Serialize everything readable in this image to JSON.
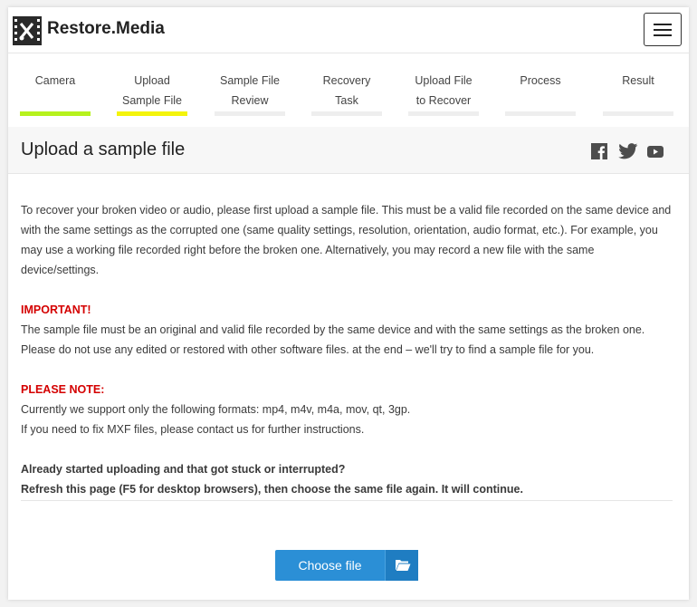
{
  "header": {
    "brand": "Restore.Media",
    "menu_icon": "hamburger-icon"
  },
  "steps": [
    {
      "line1": "Camera",
      "line2": "",
      "bar_color": "#b6f21d"
    },
    {
      "line1": "Upload",
      "line2": "Sample File",
      "bar_color": "#f4f40b"
    },
    {
      "line1": "Sample File",
      "line2": "Review",
      "bar_color": "#eeeeee"
    },
    {
      "line1": "Recovery Task",
      "line2": "",
      "bar_color": "#eeeeee"
    },
    {
      "line1": "Upload File",
      "line2": "to Recover",
      "bar_color": "#eeeeee"
    },
    {
      "line1": "Process",
      "line2": "",
      "bar_color": "#eeeeee"
    },
    {
      "line1": "Result",
      "line2": "",
      "bar_color": "#eeeeee"
    }
  ],
  "title": "Upload a sample file",
  "social": [
    "facebook-icon",
    "twitter-icon",
    "youtube-icon"
  ],
  "content": {
    "intro": "To recover your broken video or audio, please first upload a sample file. This must be a valid file recorded on the same device and with the same settings as the corrupted one (same quality settings, resolution, orientation, audio format, etc.). For example, you may use a working file recorded right before the broken one. Alternatively, you may record a new file with the same device/settings.",
    "important_label": "IMPORTANT!",
    "important_text": "The sample file must be an original and valid file recorded by the same device and with the same settings as the broken one. Please do not use any edited or restored with other software files. at the end – we'll try to find a sample file for you.",
    "note_label": "PLEASE NOTE:",
    "note_line1": "Currently we support only the following formats: mp4, m4v, m4a, mov, qt, 3gp.",
    "note_line2": "If you need to fix MXF files, please contact us for further instructions.",
    "stuck_line1": "Already started uploading and that got stuck or interrupted?",
    "stuck_line2": "Refresh this page (F5 for desktop browsers), then choose the same file again. It will continue."
  },
  "button": {
    "label": "Choose file",
    "icon": "folder-open-icon"
  },
  "colors": {
    "accent": "#2b8fd6",
    "important": "#d40000"
  }
}
